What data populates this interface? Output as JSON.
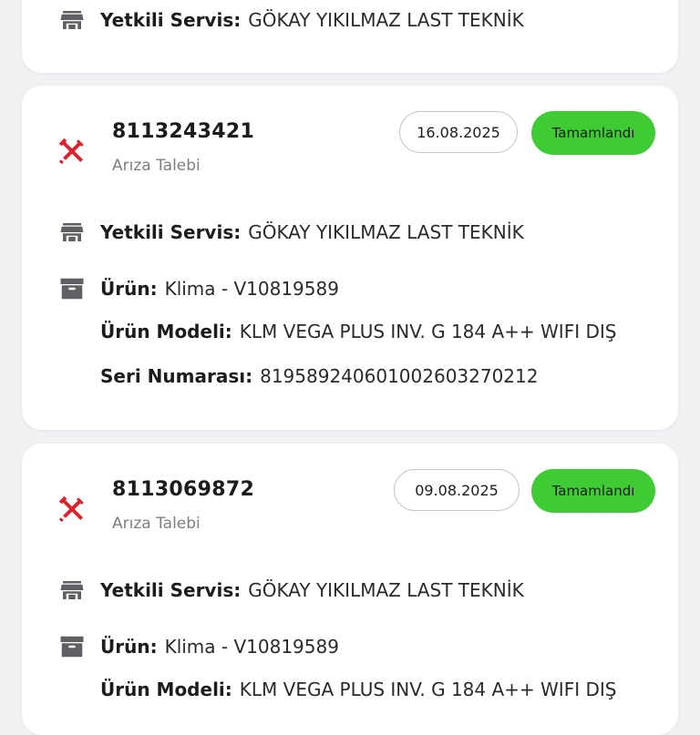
{
  "colors": {
    "status_green": "#3fcb34",
    "tool_icon_red": "#d9232e",
    "icon_gray": "#5f5f64"
  },
  "labels": {
    "service": "Yetkili Servis:",
    "product": "Ürün:",
    "model": "Ürün Modeli:",
    "serial": "Seri Numarası:"
  },
  "cards": [
    {
      "service_value": "GÖKAY YIKILMAZ LAST TEKNİK"
    },
    {
      "ticket_no": "8113243421",
      "type": "Arıza Talebi",
      "date": "16.08.2025",
      "status": "Tamamlandı",
      "icon": "tools-icon",
      "service_value": "GÖKAY YIKILMAZ LAST TEKNİK",
      "product_value": "Klima - V10819589",
      "model_value": "KLM VEGA PLUS INV. G 184 A++ WIFI DIŞ",
      "serial_value": "81958924060100260327021​2"
    },
    {
      "ticket_no": "8113069872",
      "type": "Arıza Talebi",
      "date": "09.08.2025",
      "status": "Tamamlandı",
      "icon": "tools-icon",
      "service_value": "GÖKAY YIKILMAZ LAST TEKNİK",
      "product_value": "Klima - V10819589",
      "model_value": "KLM VEGA PLUS INV. G 184 A++ WIFI DIŞ"
    }
  ]
}
